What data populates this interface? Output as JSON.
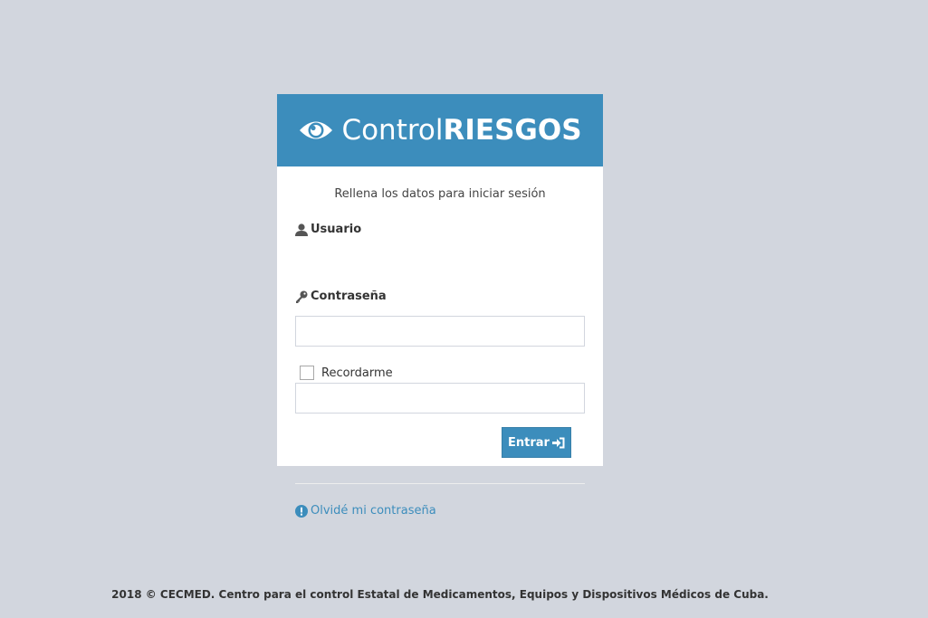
{
  "brand": {
    "prefix": "Control",
    "suffix": "RIESGOS",
    "icon": "eye-icon",
    "color": "#3c8dbc"
  },
  "login": {
    "message": "Rellena los datos para iniciar sesión",
    "username_label": "Usuario",
    "username_value": "",
    "password_label": "Contraseña",
    "password_value": "",
    "remember_label": "Recordarme",
    "remember_checked": false,
    "submit_label": "Entrar",
    "forgot_label": "Olvidé mi contraseña"
  },
  "footer": {
    "text": "2018 © CECMED. Centro para el control Estatal de Medicamentos, Equipos y Dispositivos Médicos de Cuba."
  }
}
